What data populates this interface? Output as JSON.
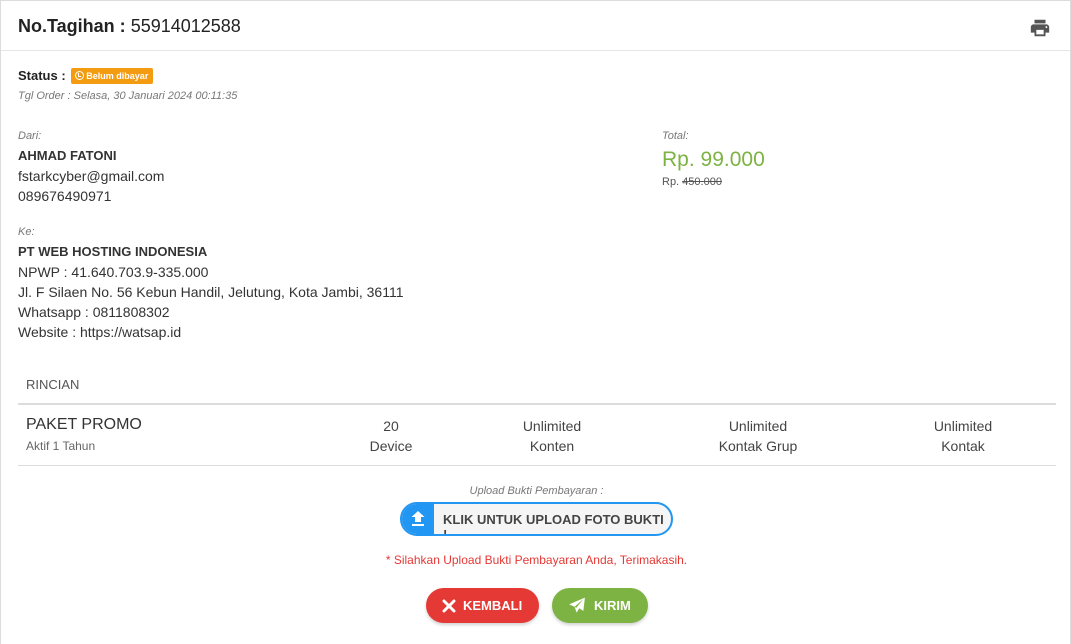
{
  "header": {
    "invoice_label": "No.Tagihan :",
    "invoice_number": "55914012588",
    "print_icon": "print-icon"
  },
  "status": {
    "label": "Status :",
    "badge": "Belum dibayar",
    "badge_icon": "clock-icon",
    "badge_color": "#f39c12",
    "order_date": "Tgl Order : Selasa, 30 Januari 2024 00:11:35"
  },
  "from": {
    "label": "Dari:",
    "name": "AHMAD FATONI",
    "email": "fstarkcyber@gmail.com",
    "phone": "089676490971"
  },
  "to": {
    "label": "Ke:",
    "name": "PT WEB HOSTING INDONESIA",
    "npwp": "NPWP : 41.640.703.9-335.000",
    "address": "Jl. F Silaen No. 56 Kebun Handil, Jelutung, Kota Jambi, 36111",
    "whatsapp": "Whatsapp : 0811808302",
    "website": "Website : https://watsap.id"
  },
  "total": {
    "label": "Total:",
    "amount": "Rp. 99.000",
    "old_prefix": "Rp.",
    "old_amount": "450.000",
    "amount_color": "#7cb342"
  },
  "rincian": {
    "label": "RINCIAN",
    "package_name": "PAKET PROMO",
    "package_sub": "Aktif 1 Tahun",
    "features": [
      {
        "top": "20",
        "bottom": "Device"
      },
      {
        "top": "Unlimited",
        "bottom": "Konten"
      },
      {
        "top": "Unlimited",
        "bottom": "Kontak Grup"
      },
      {
        "top": "Unlimited",
        "bottom": "Kontak"
      }
    ]
  },
  "upload": {
    "label": "Upload Bukti Pembayaran :",
    "button": "KLIK UNTUK UPLOAD FOTO BUKTI !",
    "icon": "upload-icon",
    "accent": "#2196f3",
    "notice": "* Silahkan Upload Bukti Pembayaran Anda, Terimakasih."
  },
  "actions": {
    "back_label": "KEMBALI",
    "back_icon": "close-icon",
    "back_color": "#e53935",
    "send_label": "KIRIM",
    "send_icon": "send-icon",
    "send_color": "#7cb342"
  }
}
